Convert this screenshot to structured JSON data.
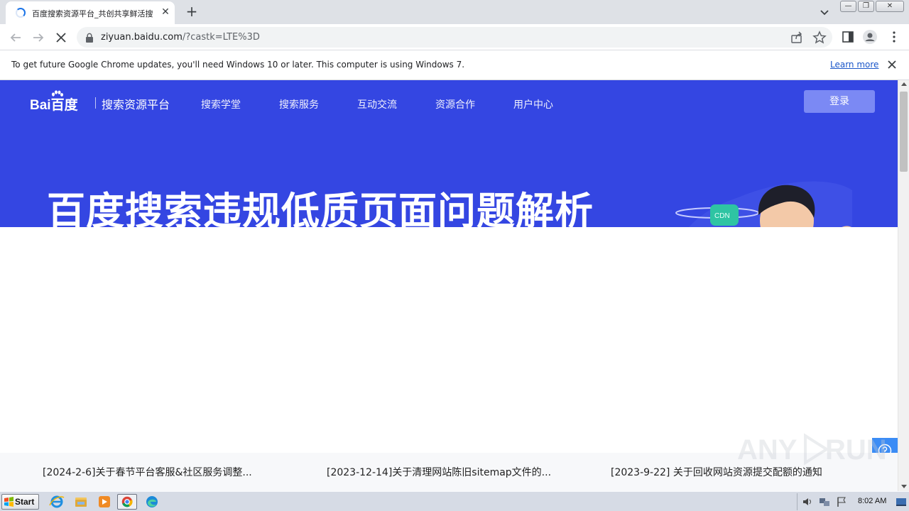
{
  "browser": {
    "tab": {
      "title": "百度搜索资源平台_共创共享鲜活搜",
      "close_glyph": "✕"
    },
    "new_tab_glyph": "+",
    "window_controls": [
      "—",
      "❐",
      "✕"
    ],
    "url_host": "ziyuan.baidu.com",
    "url_path": "/?castk=LTE%3D"
  },
  "infobar": {
    "message": "To get future Google Chrome updates, you'll need Windows 10 or later. This computer is using Windows 7.",
    "learn_more": "Learn more"
  },
  "page": {
    "logo_text": "Bai百度",
    "platform_name": "搜索资源平台",
    "nav": [
      {
        "label": "搜索学堂"
      },
      {
        "label": "搜索服务"
      },
      {
        "label": "互动交流"
      },
      {
        "label": "资源合作"
      },
      {
        "label": "用户中心"
      }
    ],
    "login_label": "登录",
    "headline": "百度搜索违规低质页面问题解析",
    "news": [
      {
        "text": "[2024-2-6]关于春节平台客服&社区服务调整..."
      },
      {
        "text": "[2023-12-14]关于清理网站陈旧sitemap文件的..."
      },
      {
        "text": "[2023-9-22] 关于回收网站资源提交配额的通知"
      }
    ],
    "colors": {
      "hero_bg": "#3446e2",
      "login_bg": "#7b89f4",
      "float_tools_bg": "#3b8cf5"
    }
  },
  "watermark": {
    "text_left": "ANY",
    "text_right": "RUN"
  },
  "taskbar": {
    "start_label": "Start",
    "apps": [
      "ie-icon",
      "explorer-icon",
      "media-player-icon",
      "chrome-icon",
      "edge-icon"
    ],
    "clock": "8:02 AM"
  }
}
